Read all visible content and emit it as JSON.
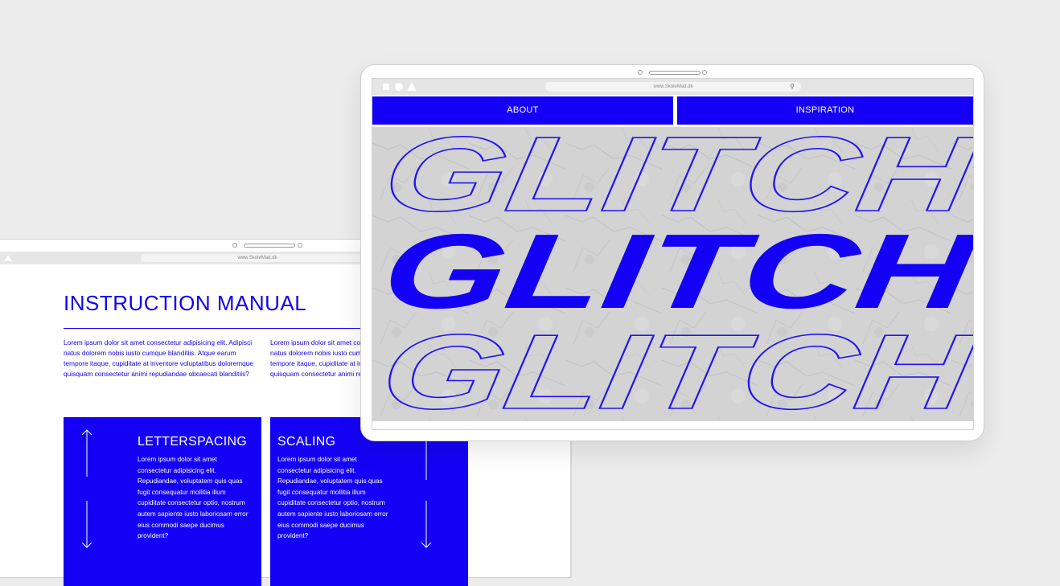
{
  "back_window": {
    "url": "www.SkoleMad.dk",
    "title": "INSTRUCTION MANUAL",
    "paragraph_1": "Lorem ipsum dolor sit amet consectetur adipisicing elit. Adipisci natus dolorem nobis iusto cumque blanditiis. Atque earum tempore itaque, cupiditate at inventore voluptatibus doloremque quisquam consectetur animi repudiandae obcaecati blanditiis?",
    "paragraph_2": "Lorem ipsum dolor sit amet consectetur adipisicing elit. Adipisci natus dolorem nobis iusto cumque blanditiis. Atque earum tempore itaque, cupiditate at inventore voluptatibus doloremque quisquam consectetur animi repudiandae obcaecati blanditiis?",
    "cards": [
      {
        "title": "LETTERSPACING",
        "text": "Lorem ipsum dolor sit amet consectetur adipisicing elit. Repudiandae, voluptatem quis quas fugit consequatur mollitia illum cupiditate consectetur optio, nostrum autem sapiente iusto laboriosam error eius commodi saepe ducimus provident?"
      },
      {
        "title": "SCALING",
        "text": "Lorem ipsum dolor sit amet consectetur adipisicing elit. Repudiandae, voluptatem quis quas fugit consequatur mollitia illum cupiditate consectetur optio, nostrum autem sapiente iusto laboriosam error eius commodi saepe ducimus provident?"
      }
    ]
  },
  "front_window": {
    "url": "www.SkoleMad.dk",
    "nav": [
      "ABOUT",
      "INSPIRATION"
    ],
    "hero_words": [
      "GLITCH",
      "GLITCH",
      "GLITCH"
    ]
  },
  "icons": [
    "triangle-icon",
    "square-icon",
    "circle-icon",
    "search-icon",
    "arrow-up-icon",
    "arrow-down-icon"
  ],
  "colors": {
    "accent": "#1400f5",
    "page_background": "#ececec",
    "hero_background": "#d2d2d2"
  }
}
